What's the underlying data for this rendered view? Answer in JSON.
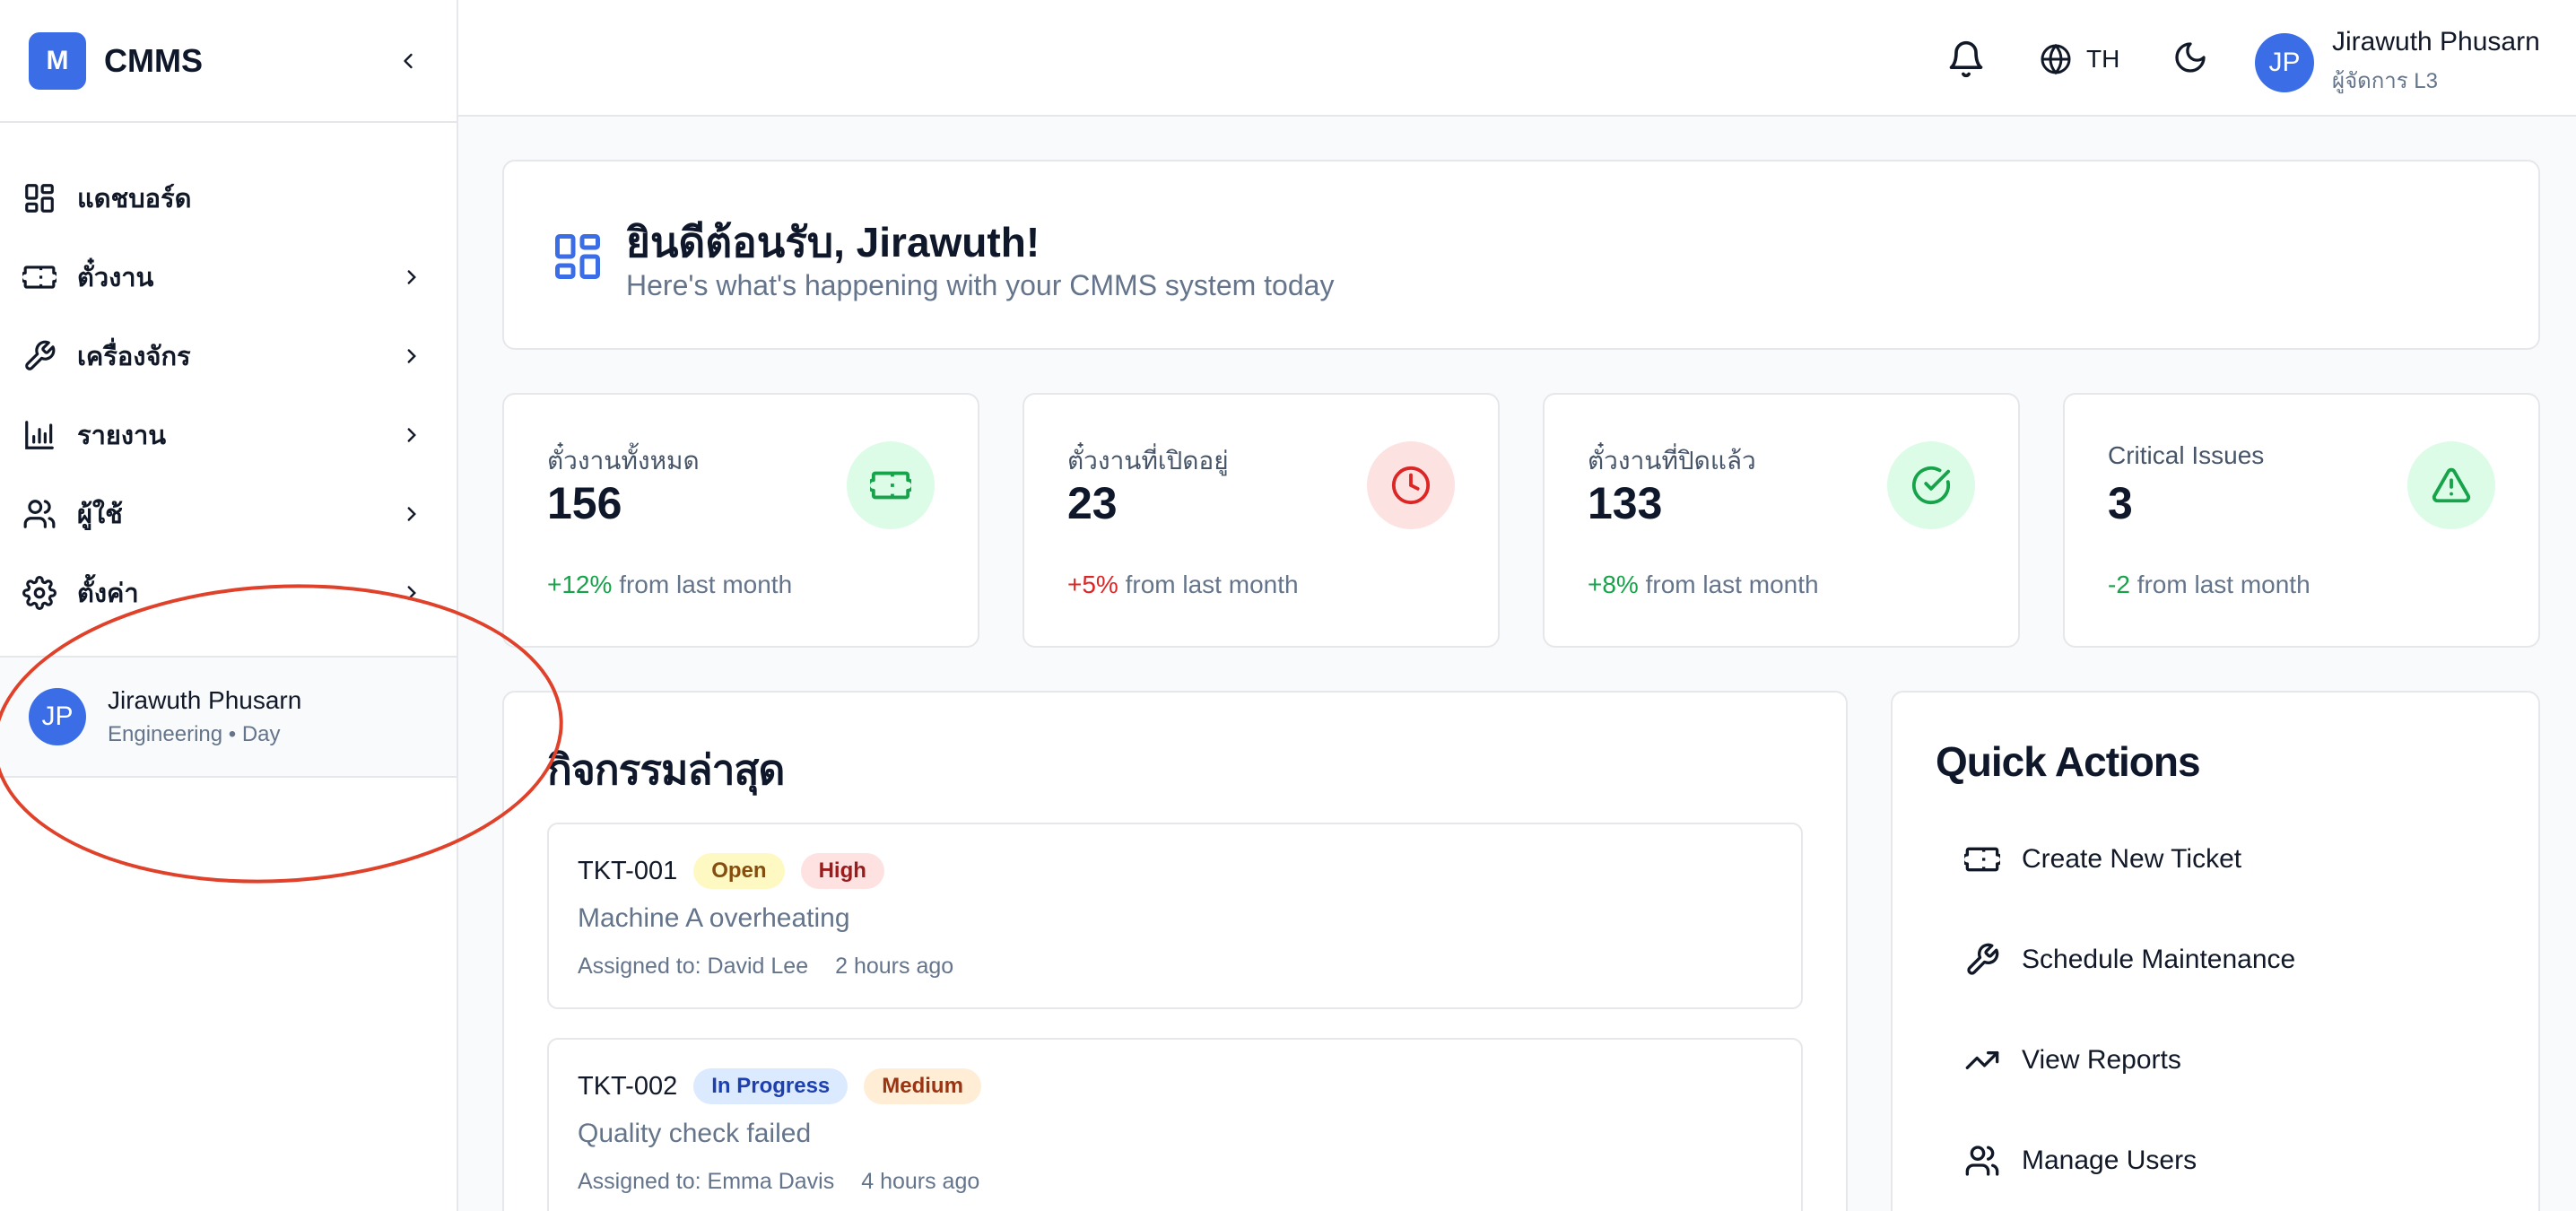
{
  "brand": {
    "logo_letter": "M",
    "name": "CMMS"
  },
  "sidebar": {
    "items": [
      {
        "label": "แดชบอร์ด",
        "icon": "dashboard-icon",
        "has_submenu": false
      },
      {
        "label": "ตั๋วงาน",
        "icon": "ticket-icon",
        "has_submenu": true
      },
      {
        "label": "เครื่องจักร",
        "icon": "wrench-icon",
        "has_submenu": true
      },
      {
        "label": "รายงาน",
        "icon": "bar-chart-icon",
        "has_submenu": true
      },
      {
        "label": "ผู้ใช้",
        "icon": "users-icon",
        "has_submenu": true
      },
      {
        "label": "ตั้งค่า",
        "icon": "gear-icon",
        "has_submenu": true
      }
    ],
    "user": {
      "initials": "JP",
      "name": "Jirawuth Phusarn",
      "subtitle": "Engineering • Day"
    }
  },
  "topbar": {
    "language": "TH",
    "user": {
      "initials": "JP",
      "name": "Jirawuth Phusarn",
      "role": "ผู้จัดการ L3"
    }
  },
  "welcome": {
    "title": "ยินดีต้อนรับ, Jirawuth!",
    "subtitle": "Here's what's happening with your CMMS system today"
  },
  "stats": [
    {
      "label": "ตั๋วงานทั้งหมด",
      "value": "156",
      "change": "+12%",
      "change_type": "positive",
      "suffix": "from last month",
      "icon": "ticket-icon",
      "icon_color": "#16a34a",
      "circle_color": "#dcfce7"
    },
    {
      "label": "ตั๋วงานที่เปิดอยู่",
      "value": "23",
      "change": "+5%",
      "change_type": "negative",
      "suffix": "from last month",
      "icon": "clock-icon",
      "icon_color": "#dc2626",
      "circle_color": "#fde2e2"
    },
    {
      "label": "ตั๋วงานที่ปิดแล้ว",
      "value": "133",
      "change": "+8%",
      "change_type": "positive",
      "suffix": "from last month",
      "icon": "check-circle-icon",
      "icon_color": "#16a34a",
      "circle_color": "#dcfce7"
    },
    {
      "label": "Critical Issues",
      "value": "3",
      "change": "-2",
      "change_type": "positive",
      "suffix": "from last month",
      "icon": "alert-triangle-icon",
      "icon_color": "#16a34a",
      "circle_color": "#dcfce7"
    }
  ],
  "activity": {
    "title": "กิจกรรมล่าสุด",
    "tickets": [
      {
        "id": "TKT-001",
        "status": "Open",
        "priority": "High",
        "title": "Machine A overheating",
        "assigned": "Assigned to: David Lee",
        "time": "2 hours ago"
      },
      {
        "id": "TKT-002",
        "status": "In Progress",
        "priority": "Medium",
        "title": "Quality check failed",
        "assigned": "Assigned to: Emma Davis",
        "time": "4 hours ago"
      }
    ]
  },
  "quick_actions": {
    "title": "Quick Actions",
    "items": [
      {
        "label": "Create New Ticket",
        "icon": "ticket-icon"
      },
      {
        "label": "Schedule Maintenance",
        "icon": "wrench-icon"
      },
      {
        "label": "View Reports",
        "icon": "trending-up-icon"
      },
      {
        "label": "Manage Users",
        "icon": "users-icon"
      }
    ]
  },
  "colors": {
    "accent": "#3b6ee6",
    "annotation": "#e0412a",
    "badge_open_bg": "#fef9c3",
    "badge_open_text": "#854d0e",
    "badge_high_bg": "#fee2e2",
    "badge_high_text": "#991b1b",
    "badge_progress_bg": "#dbeafe",
    "badge_progress_text": "#1e40af",
    "badge_medium_bg": "#ffedd5",
    "badge_medium_text": "#9a3412"
  }
}
